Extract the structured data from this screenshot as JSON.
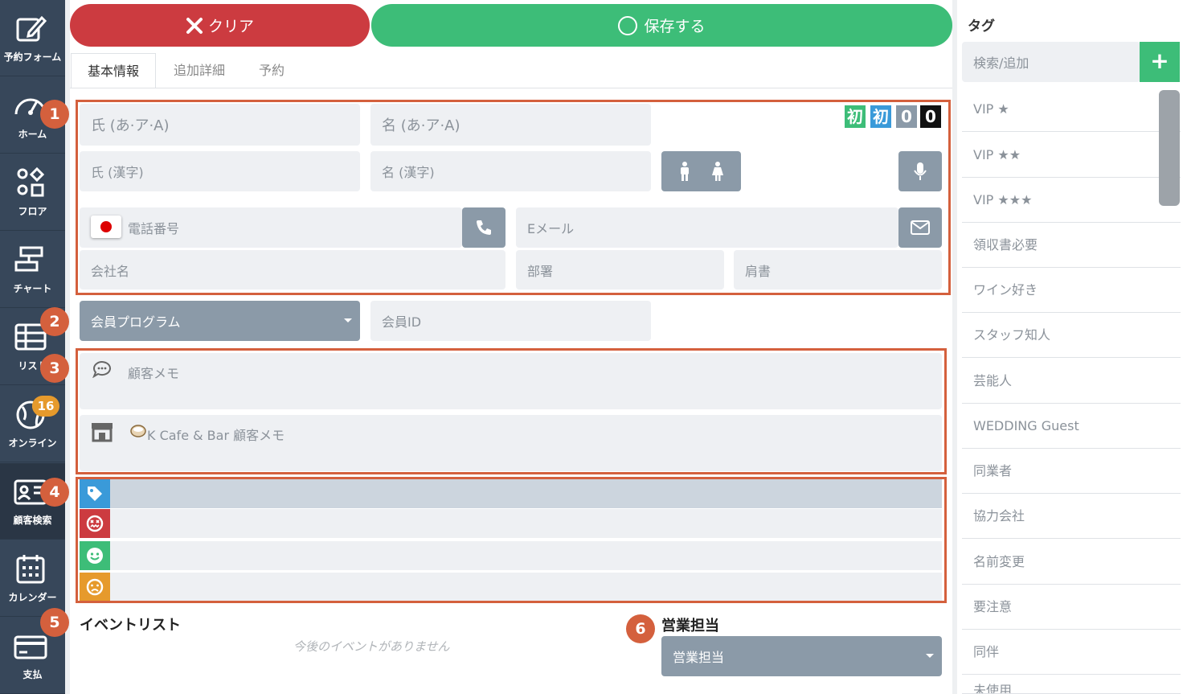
{
  "nav": [
    {
      "label": "予約フォーム",
      "icon": "edit-icon"
    },
    {
      "label": "ホーム",
      "icon": "dashboard-icon"
    },
    {
      "label": "フロア",
      "icon": "floor-icon"
    },
    {
      "label": "チャート",
      "icon": "chart-icon"
    },
    {
      "label": "リスト",
      "icon": "list-icon"
    },
    {
      "label": "オンライン",
      "icon": "globe-icon",
      "badge": "16"
    },
    {
      "label": "顧客検索",
      "icon": "customer-search-icon",
      "active": true
    },
    {
      "label": "カレンダー",
      "icon": "calendar-icon"
    },
    {
      "label": "支払",
      "icon": "payment-icon"
    }
  ],
  "actions": {
    "clear": "クリア",
    "save": "保存する"
  },
  "tabs": [
    "基本情報",
    "追加詳細",
    "予約"
  ],
  "form": {
    "last_kana": "氏 (あ·ア·A)",
    "first_kana": "名 (あ·ア·A)",
    "last_kanji": "氏 (漢字)",
    "first_kanji": "名 (漢字)",
    "phone": "電話番号",
    "email": "Eメール",
    "company": "会社名",
    "department": "部署",
    "title": "肩書",
    "member_program": "会員プログラム",
    "member_id": "会員ID",
    "customer_memo": "顧客メモ",
    "store_memo": "K Cafe & Bar 顧客メモ"
  },
  "visit_badges": [
    "初",
    "初",
    "0",
    "0"
  ],
  "callouts": [
    "1",
    "2",
    "3",
    "4",
    "5",
    "6"
  ],
  "events": {
    "title": "イベントリスト",
    "empty": "今後のイベントがありません"
  },
  "sales": {
    "title": "営業担当",
    "select": "営業担当"
  },
  "tags_panel": {
    "title": "タグ",
    "search_placeholder": "検索/追加",
    "add": "+",
    "items": [
      "VIP ★",
      "VIP ★★",
      "VIP ★★★",
      "領収書必要",
      "ワイン好き",
      "スタッフ知人",
      "芸能人",
      "WEDDING Guest",
      "同業者",
      "協力会社",
      "名前変更",
      "要注意",
      "同伴",
      "未使用"
    ]
  },
  "colors": {
    "accent_red": "#cc3b40",
    "accent_green": "#3dbd78",
    "callout": "#d4603d",
    "sidebar": "#37475a"
  }
}
